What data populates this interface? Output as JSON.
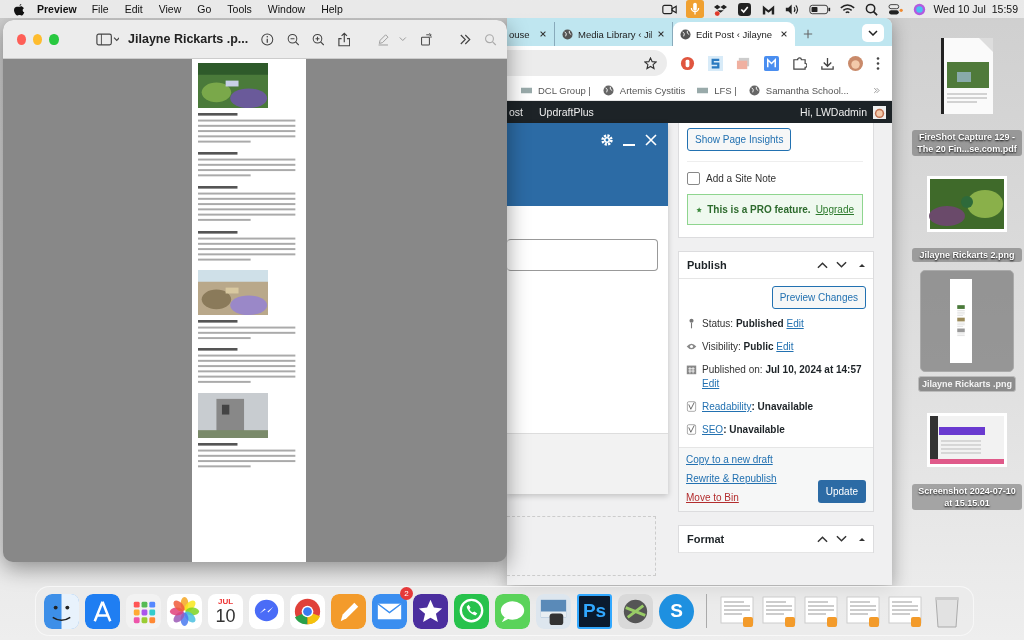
{
  "menu_bar": {
    "app": "Preview",
    "items": [
      "File",
      "Edit",
      "View",
      "Go",
      "Tools",
      "Window",
      "Help"
    ],
    "date": "Wed 10 Jul",
    "time": "15:59"
  },
  "browser": {
    "tabs": [
      {
        "title": "ouse",
        "selected": false
      },
      {
        "title": "Media Library ‹ Jil",
        "selected": false
      },
      {
        "title": "Edit Post ‹ Jilayne",
        "selected": true
      }
    ],
    "bookmarks": [
      "DCL Group |",
      "Artemis Cystitis",
      "LFS |",
      "Samantha School..."
    ],
    "admin_bar": {
      "items": [
        "ost",
        "UpdraftPlus"
      ],
      "greeting": "Hi, LWDadmin"
    },
    "sidebar": {
      "insights_button": "Show Page Insights",
      "site_note": {
        "label": "Add a Site Note",
        "checked": false
      },
      "pro_notice": {
        "text": "This is a PRO feature.",
        "link": "Upgrade"
      },
      "publish": {
        "title": "Publish",
        "preview_button": "Preview Changes",
        "rows": [
          {
            "kind": "status",
            "label": "Status: ",
            "value": "Published",
            "link": "Edit"
          },
          {
            "kind": "visibility",
            "label": "Visibility: ",
            "value": "Public",
            "link": "Edit"
          },
          {
            "kind": "date",
            "label": "Published on: ",
            "value": "Jul 10, 2024 at 14:57",
            "link": "Edit"
          },
          {
            "kind": "readability",
            "link": "Readability",
            "value": ": Unavailable"
          },
          {
            "kind": "seo",
            "link": "SEO",
            "value": ": Unavailable"
          }
        ],
        "actions": [
          "Copy to a new draft",
          "Rewrite & Republish"
        ],
        "bin": "Move to Bin",
        "update_button": "Update"
      },
      "format": {
        "title": "Format"
      }
    }
  },
  "preview_window": {
    "title": "Jilayne Rickarts .p..."
  },
  "desktop_icons": [
    {
      "label": "FireShot Capture 129 - The 20 Fin...se.com.pdf",
      "kind": "pdf",
      "selected": false
    },
    {
      "label": "Jilayne Rickarts  2.png",
      "selected": false
    },
    {
      "label": "Jilayne Rickarts .png",
      "kind": "page",
      "selected": true
    },
    {
      "label": "Screenshot 2024-07-10 at 15.15.01",
      "kind": "screen",
      "selected": false
    }
  ],
  "dock": [
    {
      "kind": "finder"
    },
    {
      "kind": "store"
    },
    {
      "kind": "grid"
    },
    {
      "kind": "flower"
    },
    {
      "kind": "calendar",
      "month": "JUL",
      "day": "10"
    },
    {
      "kind": "chat"
    },
    {
      "kind": "browser"
    },
    {
      "kind": "pen"
    },
    {
      "kind": "mail",
      "badge": "2"
    },
    {
      "kind": "star"
    },
    {
      "kind": "phone"
    },
    {
      "kind": "bubble"
    },
    {
      "kind": "preview"
    },
    {
      "kind": "ps",
      "text": "Ps"
    },
    {
      "kind": "reel"
    },
    {
      "kind": "skype",
      "text": "S"
    },
    {
      "kind": "divider"
    },
    {
      "kind": "doc"
    },
    {
      "kind": "doc"
    },
    {
      "kind": "doc"
    },
    {
      "kind": "doc"
    },
    {
      "kind": "doc"
    },
    {
      "kind": "bin"
    }
  ]
}
